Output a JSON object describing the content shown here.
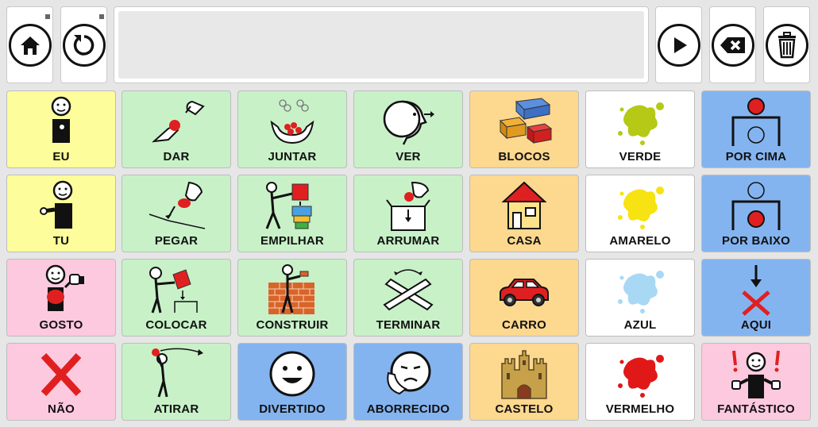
{
  "toolbar": {
    "home_icon": "home-icon",
    "undo_icon": "undo-icon",
    "play_icon": "play-icon",
    "backspace_icon": "backspace-icon",
    "trash_icon": "trash-icon",
    "message": ""
  },
  "colors": {
    "yellow": "#fdfd9b",
    "green": "#c8f1c8",
    "orange": "#fdd88f",
    "white": "#ffffff",
    "blue": "#84b4f0",
    "pink": "#fdc9df"
  },
  "grid": {
    "cells": [
      {
        "label": "EU",
        "icon": "person-pointing-self-icon"
      },
      {
        "label": "DAR",
        "icon": "hands-giving-icon"
      },
      {
        "label": "JUNTAR",
        "icon": "hands-gathering-icon"
      },
      {
        "label": "VER",
        "icon": "eye-looking-icon"
      },
      {
        "label": "BLOCOS",
        "icon": "toy-blocks-icon"
      },
      {
        "label": "VERDE",
        "icon": "green-splash-icon"
      },
      {
        "label": "POR CIMA",
        "icon": "on-top-icon"
      },
      {
        "label": "TU",
        "icon": "person-pointing-you-icon"
      },
      {
        "label": "PEGAR",
        "icon": "hand-picking-icon"
      },
      {
        "label": "EMPILHAR",
        "icon": "stacking-blocks-icon"
      },
      {
        "label": "ARRUMAR",
        "icon": "put-away-box-icon"
      },
      {
        "label": "CASA",
        "icon": "house-icon"
      },
      {
        "label": "AMARELO",
        "icon": "yellow-splash-icon"
      },
      {
        "label": "POR BAIXO",
        "icon": "below-icon"
      },
      {
        "label": "GOSTO",
        "icon": "person-likes-icon"
      },
      {
        "label": "COLOCAR",
        "icon": "person-placing-icon"
      },
      {
        "label": "CONSTRUIR",
        "icon": "person-building-wall-icon"
      },
      {
        "label": "TERMINAR",
        "icon": "crossed-arms-finish-icon"
      },
      {
        "label": "CARRO",
        "icon": "car-icon"
      },
      {
        "label": "AZUL",
        "icon": "blue-splash-icon"
      },
      {
        "label": "AQUI",
        "icon": "here-arrow-cross-icon"
      },
      {
        "label": "NÃO",
        "icon": "red-x-icon"
      },
      {
        "label": "ATIRAR",
        "icon": "person-throwing-icon"
      },
      {
        "label": "DIVERTIDO",
        "icon": "happy-face-icon"
      },
      {
        "label": "ABORRECIDO",
        "icon": "bored-face-icon"
      },
      {
        "label": "CASTELO",
        "icon": "castle-icon"
      },
      {
        "label": "VERMELHO",
        "icon": "red-splash-icon"
      },
      {
        "label": "FANTÁSTICO",
        "icon": "person-cheering-icon"
      }
    ]
  }
}
